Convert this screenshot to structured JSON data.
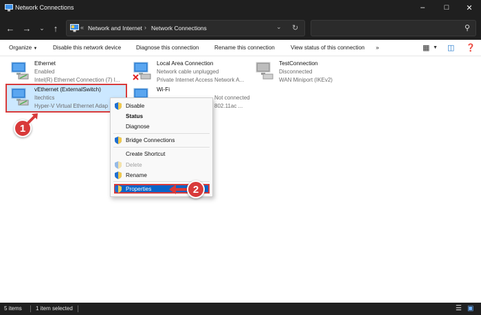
{
  "window": {
    "title": "Network Connections"
  },
  "address": {
    "overflow": "«",
    "crumbs": [
      "Network and Internet",
      "Network Connections"
    ]
  },
  "search": {
    "placeholder": ""
  },
  "toolbar": {
    "organize": "Organize",
    "items": [
      "Disable this network device",
      "Diagnose this connection",
      "Rename this connection",
      "View status of this connection"
    ],
    "more": "»"
  },
  "connections": [
    {
      "name": "Ethernet",
      "status": "Enabled",
      "adapter": "Intel(R) Ethernet Connection (7) I..."
    },
    {
      "name": "Local Area Connection",
      "status": "Network cable unplugged",
      "adapter": "Private Internet Access Network A..."
    },
    {
      "name": "TestConnection",
      "status": "Disconnected",
      "adapter": "WAN Miniport (IKEv2)"
    },
    {
      "name": "vEthernet (ExternalSwitch)",
      "status": "Itechtics",
      "adapter": "Hyper-V Virtual Ethernet Adap"
    },
    {
      "name": "Wi-Fi",
      "status": "Not connected",
      "adapter": "802.11ac ..."
    }
  ],
  "context_menu": {
    "disable": "Disable",
    "status": "Status",
    "diagnose": "Diagnose",
    "bridge": "Bridge Connections",
    "shortcut": "Create Shortcut",
    "delete": "Delete",
    "rename": "Rename",
    "properties": "Properties"
  },
  "annotations": {
    "step1": "1",
    "step2": "2",
    "color": "#d83a3a"
  },
  "statusbar": {
    "items_count": "5 items",
    "selected": "1 item selected"
  },
  "colors": {
    "selection": "#cce8ff",
    "menu_highlight": "#0a64c8",
    "dark_chrome": "#1f1f1f"
  }
}
